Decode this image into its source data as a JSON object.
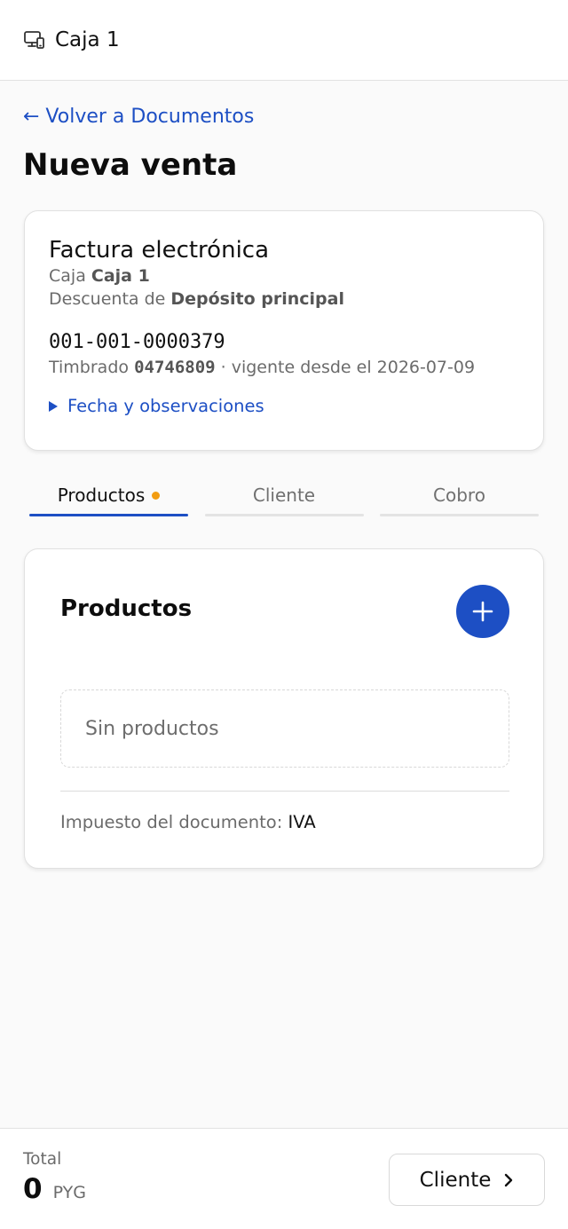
{
  "header": {
    "title": "Caja 1",
    "icon": "devices-icon"
  },
  "nav": {
    "back_label": "← Volver a Documentos"
  },
  "page": {
    "title": "Nueva venta"
  },
  "document": {
    "type": "Factura electrónica",
    "register_prefix": "Caja ",
    "register_name": "Caja 1",
    "warehouse_prefix": "Descuenta de ",
    "warehouse_name": "Depósito principal",
    "number": "001-001-0000379",
    "stamp_prefix": "Timbrado ",
    "stamp_number": "04746809",
    "stamp_suffix": " · vigente desde el 2026-07-09",
    "details_toggle": "Fecha y observaciones"
  },
  "tabs": [
    {
      "label": "Productos",
      "active": true,
      "indicator_color": "#f29d12"
    },
    {
      "label": "Cliente",
      "active": false
    },
    {
      "label": "Cobro",
      "active": false
    }
  ],
  "products": {
    "title": "Productos",
    "empty_text": "Sin productos",
    "tax_label": "Impuesto del documento: ",
    "tax_value": "IVA"
  },
  "footer": {
    "total_label": "Total",
    "total_value": "0",
    "currency": "PYG",
    "next_label": "Cliente"
  },
  "colors": {
    "accent": "#1d4fc4",
    "pending_dot": "#f29d12"
  }
}
